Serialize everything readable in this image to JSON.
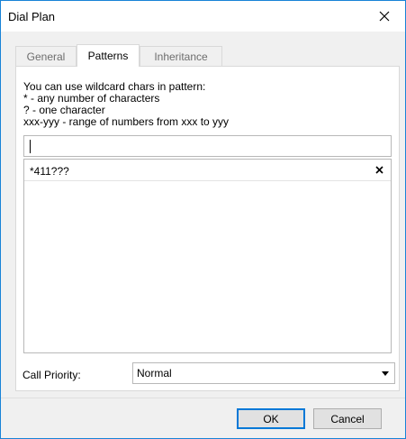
{
  "window": {
    "title": "Dial Plan",
    "close_icon": "close-icon"
  },
  "tabs": [
    {
      "label": "General",
      "active": false
    },
    {
      "label": "Patterns",
      "active": true
    },
    {
      "label": "Inheritance",
      "active": false
    }
  ],
  "patterns": {
    "help_lines": [
      "You can use wildcard chars in pattern:",
      "* - any number of characters",
      "? - one character",
      "xxx-yyy - range of numbers from xxx to yyy"
    ],
    "input_value": "",
    "items": [
      {
        "pattern": "*411???",
        "remove_icon": "close-icon"
      }
    ]
  },
  "priority": {
    "label": "Call Priority:",
    "selected": "Normal",
    "arrow_icon": "chevron-down-icon"
  },
  "buttons": {
    "ok": "OK",
    "cancel": "Cancel"
  },
  "colors": {
    "border_accent": "#1883d7",
    "default_button": "#0078d7"
  }
}
